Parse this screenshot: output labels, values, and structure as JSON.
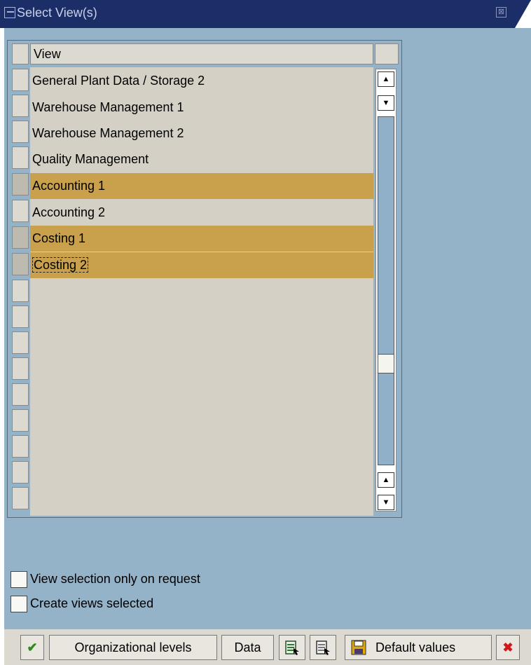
{
  "window": {
    "title": "Select View(s)",
    "close_glyph": "⊠"
  },
  "table": {
    "header": "View",
    "rows": [
      {
        "label": "General Plant Data / Storage 2",
        "selected": false
      },
      {
        "label": "Warehouse Management 1",
        "selected": false
      },
      {
        "label": "Warehouse Management 2",
        "selected": false
      },
      {
        "label": "Quality Management",
        "selected": false
      },
      {
        "label": "Accounting 1",
        "selected": true
      },
      {
        "label": "Accounting 2",
        "selected": false
      },
      {
        "label": "Costing 1",
        "selected": true
      },
      {
        "label": "Costing 2",
        "selected": true
      }
    ],
    "scroll_up_glyph": "▲",
    "scroll_down_glyph": "▼"
  },
  "options": {
    "view_selection_label": "View selection only on request",
    "view_selection_checked": false,
    "create_views_label": "Create views selected",
    "create_views_checked": false
  },
  "toolbar": {
    "continue_glyph": "✔",
    "org_levels_label": "Organizational levels",
    "data_label": "Data",
    "select_all_icon": "select-all-icon",
    "deselect_all_icon": "deselect-all-icon",
    "save_glyph": "💾",
    "default_values_label": "Default values",
    "cancel_glyph": "✖"
  },
  "colors": {
    "title_bar": "#1c2e68",
    "background": "#94b2c8",
    "selection": "#c9a04c",
    "row_bg": "#d4d0c6"
  }
}
